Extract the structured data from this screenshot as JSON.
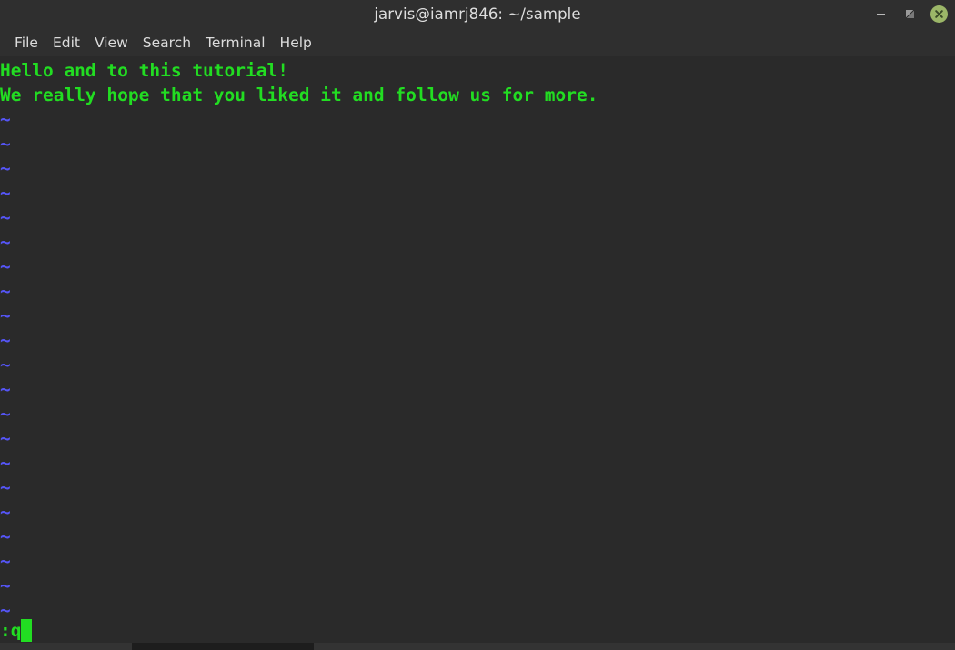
{
  "window": {
    "title": "jarvis@iamrj846: ~/sample",
    "controls": {
      "minimize_label": "minimize",
      "maximize_label": "restore",
      "close_label": "close"
    },
    "colors": {
      "titlebar_bg": "#2f2f2f",
      "terminal_bg": "#2a2a2a",
      "menu_text": "#dcdcdc",
      "title_text": "#dedede",
      "close_button": "#9bb668",
      "text_green": "#22dd22",
      "tilde_blue": "#5555f5"
    }
  },
  "menubar": {
    "items": [
      {
        "label": "File"
      },
      {
        "label": "Edit"
      },
      {
        "label": "View"
      },
      {
        "label": "Search"
      },
      {
        "label": "Terminal"
      },
      {
        "label": "Help"
      }
    ]
  },
  "terminal": {
    "content_lines": [
      "Hello and to this tutorial!",
      "We really hope that you liked it and follow us for more."
    ],
    "empty_line_marker": "~",
    "empty_line_count": 21,
    "status_line": {
      "text": ":q",
      "cursor": "block"
    }
  }
}
